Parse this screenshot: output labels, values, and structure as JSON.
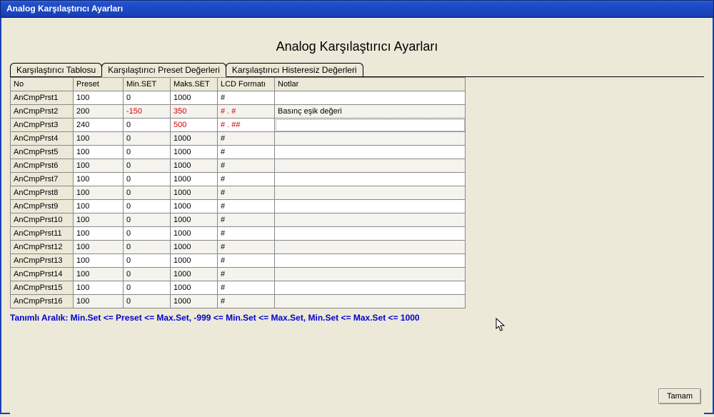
{
  "window": {
    "title": "Analog Karşılaştırıcı Ayarları"
  },
  "heading": "Analog Karşılaştırıcı Ayarları",
  "tabs": [
    {
      "label": "Karşılaştırıcı Tablosu",
      "active": false
    },
    {
      "label": "Karşılaştırıcı Preset Değerleri",
      "active": true
    },
    {
      "label": "Karşılaştırıcı Histeresiz Değerleri",
      "active": false
    }
  ],
  "columns": {
    "no": "No",
    "preset": "Preset",
    "minset": "Min.SET",
    "maksset": "Maks.SET",
    "lcd": "LCD Formatı",
    "notlar": "Notlar"
  },
  "rows": [
    {
      "no": "AnCmpPrst1",
      "preset": "100",
      "min": "0",
      "max": "1000",
      "lcd": "#",
      "not": "",
      "min_red": false,
      "max_red": false,
      "lcd_red": false
    },
    {
      "no": "AnCmpPrst2",
      "preset": "200",
      "min": "-150",
      "max": "350",
      "lcd": "# . #",
      "not": "Basınç eşik değeri",
      "min_red": true,
      "max_red": true,
      "lcd_red": true
    },
    {
      "no": "AnCmpPrst3",
      "preset": "240",
      "min": "0",
      "max": "500",
      "lcd": "# . ##",
      "not": "",
      "min_red": false,
      "max_red": true,
      "lcd_red": true,
      "editing": true
    },
    {
      "no": "AnCmpPrst4",
      "preset": "100",
      "min": "0",
      "max": "1000",
      "lcd": "#",
      "not": "",
      "min_red": false,
      "max_red": false,
      "lcd_red": false
    },
    {
      "no": "AnCmpPrst5",
      "preset": "100",
      "min": "0",
      "max": "1000",
      "lcd": "#",
      "not": "",
      "min_red": false,
      "max_red": false,
      "lcd_red": false
    },
    {
      "no": "AnCmpPrst6",
      "preset": "100",
      "min": "0",
      "max": "1000",
      "lcd": "#",
      "not": "",
      "min_red": false,
      "max_red": false,
      "lcd_red": false
    },
    {
      "no": "AnCmpPrst7",
      "preset": "100",
      "min": "0",
      "max": "1000",
      "lcd": "#",
      "not": "",
      "min_red": false,
      "max_red": false,
      "lcd_red": false
    },
    {
      "no": "AnCmpPrst8",
      "preset": "100",
      "min": "0",
      "max": "1000",
      "lcd": "#",
      "not": "",
      "min_red": false,
      "max_red": false,
      "lcd_red": false
    },
    {
      "no": "AnCmpPrst9",
      "preset": "100",
      "min": "0",
      "max": "1000",
      "lcd": "#",
      "not": "",
      "min_red": false,
      "max_red": false,
      "lcd_red": false
    },
    {
      "no": "AnCmpPrst10",
      "preset": "100",
      "min": "0",
      "max": "1000",
      "lcd": "#",
      "not": "",
      "min_red": false,
      "max_red": false,
      "lcd_red": false
    },
    {
      "no": "AnCmpPrst11",
      "preset": "100",
      "min": "0",
      "max": "1000",
      "lcd": "#",
      "not": "",
      "min_red": false,
      "max_red": false,
      "lcd_red": false
    },
    {
      "no": "AnCmpPrst12",
      "preset": "100",
      "min": "0",
      "max": "1000",
      "lcd": "#",
      "not": "",
      "min_red": false,
      "max_red": false,
      "lcd_red": false
    },
    {
      "no": "AnCmpPrst13",
      "preset": "100",
      "min": "0",
      "max": "1000",
      "lcd": "#",
      "not": "",
      "min_red": false,
      "max_red": false,
      "lcd_red": false
    },
    {
      "no": "AnCmpPrst14",
      "preset": "100",
      "min": "0",
      "max": "1000",
      "lcd": "#",
      "not": "",
      "min_red": false,
      "max_red": false,
      "lcd_red": false
    },
    {
      "no": "AnCmpPrst15",
      "preset": "100",
      "min": "0",
      "max": "1000",
      "lcd": "#",
      "not": "",
      "min_red": false,
      "max_red": false,
      "lcd_red": false
    },
    {
      "no": "AnCmpPrst16",
      "preset": "100",
      "min": "0",
      "max": "1000",
      "lcd": "#",
      "not": "",
      "min_red": false,
      "max_red": false,
      "lcd_red": false
    }
  ],
  "footer_rule": "Tanımlı Aralık:   Min.Set <= Preset <= Max.Set,   -999 <= Min.Set <= Max.Set,   Min.Set <= Max.Set <= 1000",
  "ok_label": "Tamam"
}
